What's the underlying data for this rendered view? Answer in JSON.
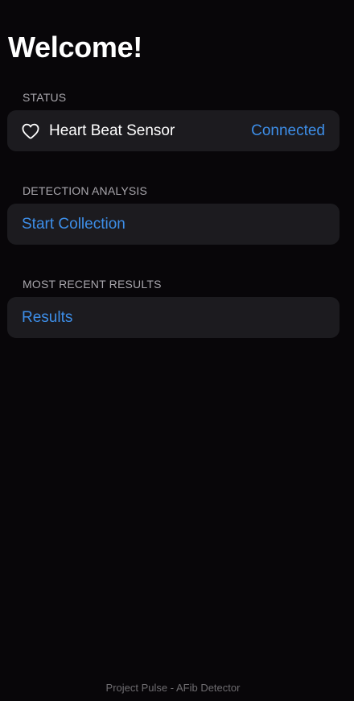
{
  "header": {
    "title": "Welcome!"
  },
  "status": {
    "section_label": "STATUS",
    "sensor_icon": "heart-icon",
    "sensor_label": "Heart Beat Sensor",
    "sensor_state": "Connected"
  },
  "detection": {
    "section_label": "DETECTION ANALYSIS",
    "action_label": "Start Collection"
  },
  "results": {
    "section_label": "MOST RECENT RESULTS",
    "action_label": "Results"
  },
  "footer": {
    "text": "Project Pulse - AFib Detector"
  },
  "colors": {
    "background": "#080609",
    "card": "#1c1b1f",
    "accent": "#3d8ee8",
    "section_label": "#a9a7ad"
  }
}
